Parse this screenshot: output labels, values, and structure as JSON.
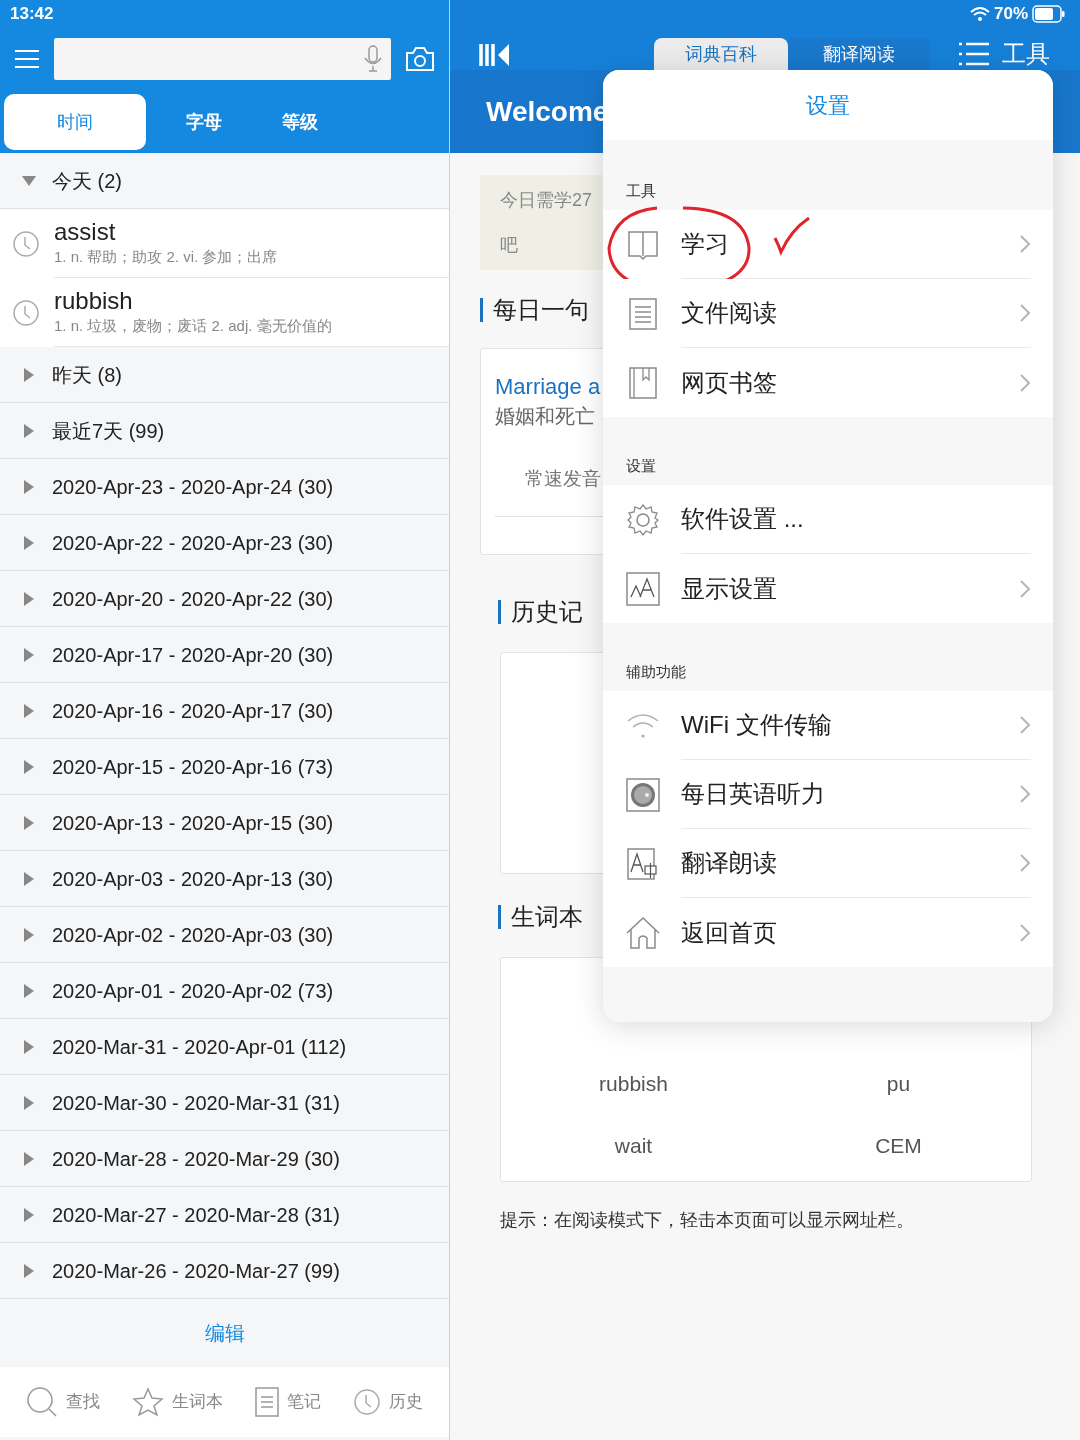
{
  "status_bar": {
    "time": "13:42",
    "battery": "70%"
  },
  "left": {
    "tabs": [
      {
        "label": "时间",
        "selected": true
      },
      {
        "label": "字母",
        "selected": false
      },
      {
        "label": "等级",
        "selected": false
      }
    ],
    "groups": [
      {
        "label": "今天 (2)",
        "expanded": true,
        "children": [
          {
            "word": "assist",
            "definition": "1. n. 帮助；助攻 2. vi. 参加；出席"
          },
          {
            "word": "rubbish",
            "definition": "1. n. 垃圾，废物；废话 2. adj. 毫无价值的"
          }
        ]
      },
      {
        "label": "昨天 (8)",
        "expanded": false
      },
      {
        "label": "最近7天 (99)",
        "expanded": false
      },
      {
        "label": "2020-Apr-23 - 2020-Apr-24 (30)",
        "expanded": false
      },
      {
        "label": "2020-Apr-22 - 2020-Apr-23 (30)",
        "expanded": false
      },
      {
        "label": "2020-Apr-20 - 2020-Apr-22 (30)",
        "expanded": false
      },
      {
        "label": "2020-Apr-17 - 2020-Apr-20 (30)",
        "expanded": false
      },
      {
        "label": "2020-Apr-16 - 2020-Apr-17 (30)",
        "expanded": false
      },
      {
        "label": "2020-Apr-15 - 2020-Apr-16 (73)",
        "expanded": false
      },
      {
        "label": "2020-Apr-13 - 2020-Apr-15 (30)",
        "expanded": false
      },
      {
        "label": "2020-Apr-03 - 2020-Apr-13 (30)",
        "expanded": false
      },
      {
        "label": "2020-Apr-02 - 2020-Apr-03 (30)",
        "expanded": false
      },
      {
        "label": "2020-Apr-01 - 2020-Apr-02 (73)",
        "expanded": false
      },
      {
        "label": "2020-Mar-31 - 2020-Apr-01 (112)",
        "expanded": false
      },
      {
        "label": "2020-Mar-30 - 2020-Mar-31 (31)",
        "expanded": false
      },
      {
        "label": "2020-Mar-28 - 2020-Mar-29 (30)",
        "expanded": false
      },
      {
        "label": "2020-Mar-27 - 2020-Mar-28 (31)",
        "expanded": false
      },
      {
        "label": "2020-Mar-26 - 2020-Mar-27 (99)",
        "expanded": false
      }
    ],
    "edit_button": "编辑",
    "bottom_nav": [
      {
        "label": "查找"
      },
      {
        "label": "生词本"
      },
      {
        "label": "笔记"
      },
      {
        "label": "历史"
      }
    ]
  },
  "right": {
    "tabs": [
      {
        "label": "词典百科",
        "selected": true
      },
      {
        "label": "翻译阅读",
        "selected": false
      }
    ],
    "tools_button": "工具",
    "welcome": "Welcome",
    "daily_plan": {
      "line_1": "今日需学27",
      "line_2": "吧"
    },
    "daily_sentence": {
      "heading": "每日一句",
      "title": "Marriage a",
      "translation": "婚姻和死亡",
      "audio": "常速发音"
    },
    "history": {
      "heading": "历史记"
    },
    "wordbook": {
      "heading": "生词本",
      "words": [
        "rubbish",
        "pu",
        "wait",
        "CEM"
      ]
    },
    "hint": "提示：在阅读模式下，轻击本页面可以显示网址栏。"
  },
  "popover": {
    "title": "设置",
    "sections": [
      {
        "heading": "工具",
        "items": [
          {
            "label": "学习",
            "chevron": true,
            "annotated": true
          },
          {
            "label": "文件阅读",
            "chevron": true,
            "annotated": false
          },
          {
            "label": "网页书签",
            "chevron": true,
            "annotated": false
          }
        ]
      },
      {
        "heading": "设置",
        "items": [
          {
            "label": "软件设置 ...",
            "chevron": false,
            "annotated": false
          },
          {
            "label": "显示设置",
            "chevron": true,
            "annotated": false
          }
        ]
      },
      {
        "heading": "辅助功能",
        "items": [
          {
            "label": "WiFi 文件传输",
            "chevron": true,
            "annotated": false
          },
          {
            "label": "每日英语听力",
            "chevron": true,
            "annotated": false
          },
          {
            "label": "翻译朗读",
            "chevron": true,
            "annotated": false
          },
          {
            "label": "返回首页",
            "chevron": true,
            "annotated": false
          }
        ]
      }
    ]
  }
}
